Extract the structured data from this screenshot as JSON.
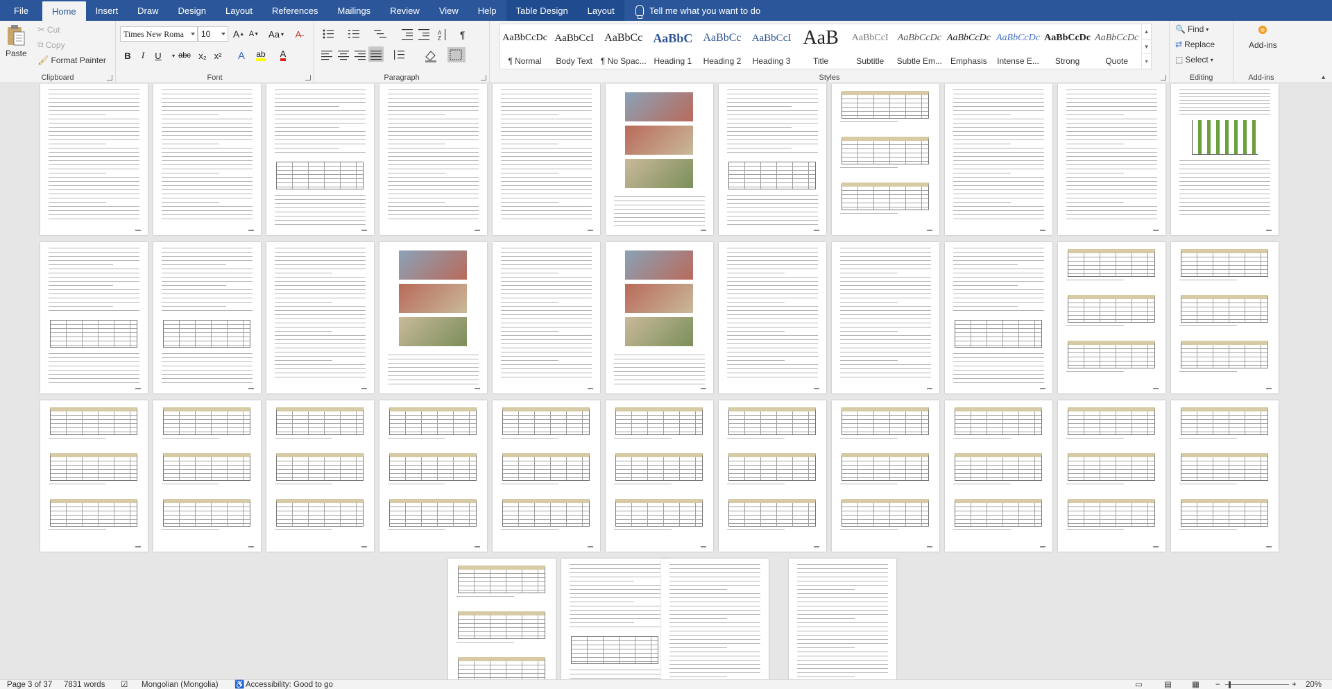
{
  "tabs": {
    "file": "File",
    "home": "Home",
    "insert": "Insert",
    "draw": "Draw",
    "design": "Design",
    "layout": "Layout",
    "references": "References",
    "mailings": "Mailings",
    "review": "Review",
    "view": "View",
    "help": "Help",
    "table_design": "Table Design",
    "table_layout": "Layout",
    "tell_me": "Tell me what you want to do"
  },
  "clipboard": {
    "paste": "Paste",
    "cut": "Cut",
    "copy": "Copy",
    "format_painter": "Format Painter",
    "label": "Clipboard"
  },
  "font": {
    "name": "Times New Roma",
    "size": "10",
    "bold": "B",
    "italic": "I",
    "underline": "U",
    "strikethrough": "abc",
    "subscript": "x₂",
    "superscript": "x²",
    "case": "Aa",
    "grow": "A",
    "shrink": "A",
    "label": "Font"
  },
  "paragraph": {
    "label": "Paragraph"
  },
  "styles": {
    "label": "Styles",
    "items": [
      {
        "preview": "AaBbCcDc",
        "name": "¶ Normal"
      },
      {
        "preview": "AaBbCcI",
        "name": "Body Text"
      },
      {
        "preview": "AaBbCc",
        "name": "¶ No Spac..."
      },
      {
        "preview": "AaBbC",
        "name": "Heading 1"
      },
      {
        "preview": "AaBbCc",
        "name": "Heading 2"
      },
      {
        "preview": "AaBbCcI",
        "name": "Heading 3"
      },
      {
        "preview": "AaB",
        "name": "Title"
      },
      {
        "preview": "AaBbCcI",
        "name": "Subtitle"
      },
      {
        "preview": "AaBbCcDc",
        "name": "Subtle Em..."
      },
      {
        "preview": "AaBbCcDc",
        "name": "Emphasis"
      },
      {
        "preview": "AaBbCcDc",
        "name": "Intense E..."
      },
      {
        "preview": "AaBbCcDc",
        "name": "Strong"
      },
      {
        "preview": "AaBbCcDc",
        "name": "Quote"
      }
    ]
  },
  "editing": {
    "find": "Find",
    "replace": "Replace",
    "select": "Select",
    "label": "Editing"
  },
  "addins": {
    "button": "Add-ins",
    "label": "Add-ins"
  },
  "status": {
    "page": "Page 3 of 37",
    "words": "7831 words",
    "language": "Mongolian (Mongolia)",
    "accessibility": "Accessibility: Good to go",
    "zoom": "20%"
  },
  "colors": {
    "ribbon_tab_bar": "#2b579a",
    "highlight": "#ffff00",
    "font_color": "#e0201c"
  }
}
